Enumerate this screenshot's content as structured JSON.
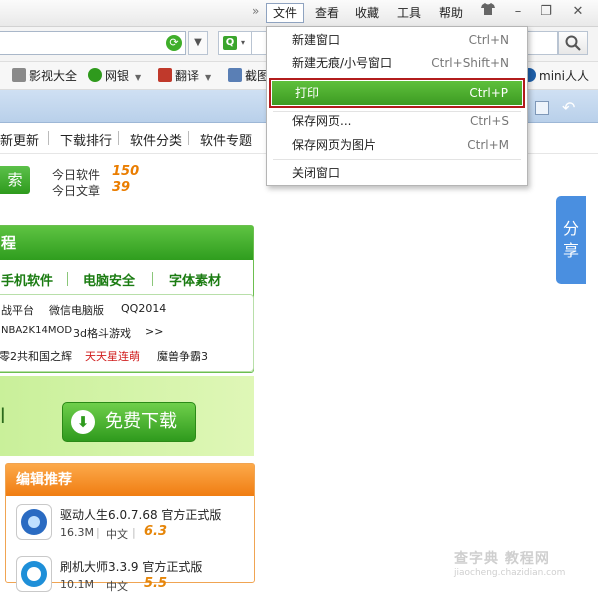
{
  "menubar": {
    "chevron": "»",
    "items": [
      "文件",
      "查看",
      "收藏",
      "工具",
      "帮助"
    ],
    "window_buttons": {
      "minimize": "–",
      "restore": "❐",
      "close": "✕"
    }
  },
  "favorites": [
    {
      "label": "影视大全",
      "color": "#8a8a8a"
    },
    {
      "label": "网银",
      "color": "#2f9a1d",
      "has_arrow": true
    },
    {
      "label": "翻译",
      "color": "#c0392b",
      "has_arrow": true
    },
    {
      "label": "截图",
      "color": "#5a7fb5"
    },
    {
      "label": "mini人人",
      "color": "#1f5fa8"
    }
  ],
  "site_nav": [
    "新更新",
    "下载排行",
    "软件分类",
    "软件专题"
  ],
  "search_button_label": "索",
  "stats": {
    "today_software_label": "今日软件",
    "today_software_value": "150",
    "today_article_label": "今日文章",
    "today_article_value": "39"
  },
  "category_panel": {
    "title": "程",
    "tabs": [
      "手机软件",
      "电脑安全",
      "字体素材"
    ],
    "links": [
      [
        "战平台",
        "微信电脑版",
        "QQ2014"
      ],
      [
        "NBA2K14MOD",
        "3d格斗游戏",
        ">>"
      ],
      [
        "零2共和国之辉",
        "天天星连萌",
        "魔兽争霸3"
      ]
    ],
    "highlight_color": "#d01c1c"
  },
  "download": {
    "label": "免费下载",
    "side_char": "l"
  },
  "recommend": {
    "title": "编辑推荐",
    "apps": [
      {
        "name": "驱动人生6.0.7.68 官方正式版",
        "size": "16.3M",
        "lang": "中文",
        "score": "6.3"
      },
      {
        "name": "刷机大师3.3.9 官方正式版",
        "size": "10.1M",
        "lang": "中文",
        "score": "5.5"
      }
    ]
  },
  "share": {
    "label": "分享"
  },
  "file_menu": {
    "items": [
      {
        "label": "新建窗口",
        "shortcut": "Ctrl+N"
      },
      {
        "label": "新建无痕/小号窗口",
        "shortcut": "Ctrl+Shift+N"
      },
      {
        "label": "打印",
        "shortcut": "Ctrl+P",
        "highlighted": true
      },
      {
        "label": "保存网页...",
        "shortcut": "Ctrl+S"
      },
      {
        "label": "保存网页为图片",
        "shortcut": "Ctrl+M"
      },
      {
        "label": "关闭窗口",
        "shortcut": ""
      }
    ]
  },
  "watermark": {
    "line1": "查字典 教程网",
    "line2": "jiaocheng.chazidian.com"
  }
}
